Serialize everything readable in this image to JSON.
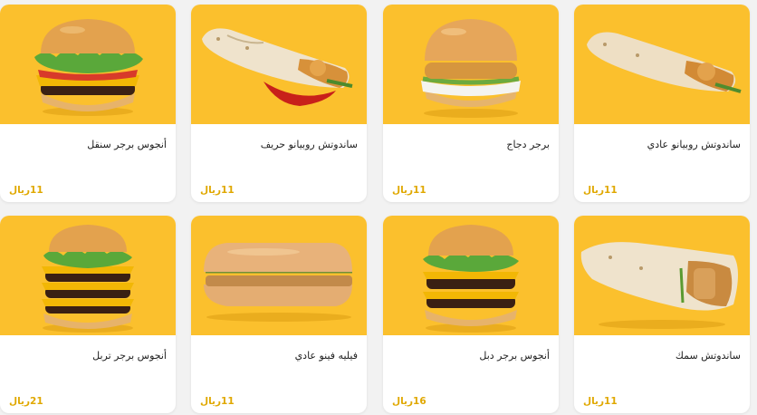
{
  "menu": {
    "currency": "ريال",
    "items": [
      {
        "name": "أنجوس برجر سنقل",
        "price": "11",
        "image": "single-burger"
      },
      {
        "name": "ساندوتش روبيانو حريف",
        "price": "11",
        "image": "spicy-shrimp-wrap"
      },
      {
        "name": "برجر دجاج",
        "price": "11",
        "image": "chicken-burger"
      },
      {
        "name": "ساندوتش روبيانو عادي",
        "price": "11",
        "image": "shrimp-wrap"
      },
      {
        "name": "أنجوس برجر تربل",
        "price": "21",
        "image": "triple-burger"
      },
      {
        "name": "فيليه فينو عادي",
        "price": "11",
        "image": "fish-fino-sub"
      },
      {
        "name": "أنجوس برجر دبل",
        "price": "16",
        "image": "double-burger"
      },
      {
        "name": "ساندوتش سمك",
        "price": "11",
        "image": "fish-wrap"
      }
    ]
  },
  "colors": {
    "photo_background": "#fbc02d",
    "price": "#e0a800",
    "card": "#ffffff",
    "page": "#f2f2f2"
  }
}
